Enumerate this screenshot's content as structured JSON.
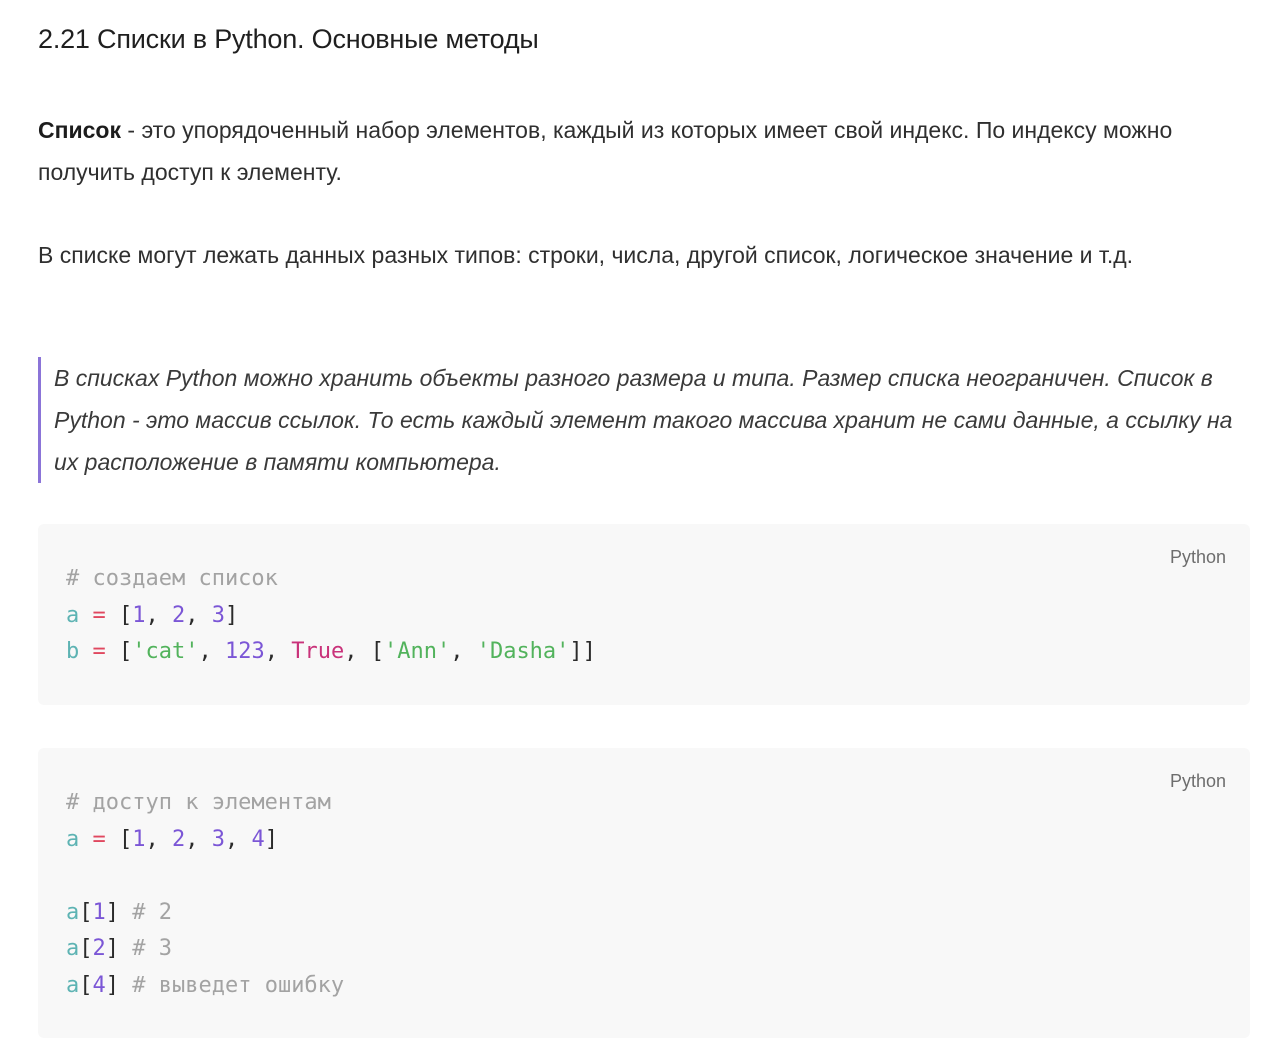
{
  "title": "2.21 Списки в Python. Основные методы",
  "para1": {
    "term": "Список",
    "text": " - это упорядоченный набор элементов, каждый из которых имеет свой индекс. По индексу можно получить доступ к элементу."
  },
  "para2": "В списке могут лежать данных разных типов: строки, числа, другой список, логическое значение и т.д.",
  "quote": "В списках Python можно хранить объекты разного размера и типа. Размер списка неограничен. Список в Python - это массив ссылок. То есть каждый элемент такого массива хранит не сами данные, а ссылку на их расположение в памяти компьютера.",
  "code_blocks": [
    {
      "language": "Python",
      "lines": [
        [
          {
            "t": "# создаем список",
            "k": "comment"
          }
        ],
        [
          {
            "t": "a",
            "k": "var"
          },
          {
            "t": " ",
            "k": "punc"
          },
          {
            "t": "=",
            "k": "op"
          },
          {
            "t": " [",
            "k": "punc"
          },
          {
            "t": "1",
            "k": "num"
          },
          {
            "t": ", ",
            "k": "punc"
          },
          {
            "t": "2",
            "k": "num"
          },
          {
            "t": ", ",
            "k": "punc"
          },
          {
            "t": "3",
            "k": "num"
          },
          {
            "t": "]",
            "k": "punc"
          }
        ],
        [
          {
            "t": "b",
            "k": "var"
          },
          {
            "t": " ",
            "k": "punc"
          },
          {
            "t": "=",
            "k": "op"
          },
          {
            "t": " [",
            "k": "punc"
          },
          {
            "t": "'cat'",
            "k": "str"
          },
          {
            "t": ", ",
            "k": "punc"
          },
          {
            "t": "123",
            "k": "num"
          },
          {
            "t": ", ",
            "k": "punc"
          },
          {
            "t": "True",
            "k": "bool"
          },
          {
            "t": ", [",
            "k": "punc"
          },
          {
            "t": "'Ann'",
            "k": "str"
          },
          {
            "t": ", ",
            "k": "punc"
          },
          {
            "t": "'Dasha'",
            "k": "str"
          },
          {
            "t": "]]",
            "k": "punc"
          }
        ]
      ]
    },
    {
      "language": "Python",
      "lines": [
        [
          {
            "t": "# доступ к элементам",
            "k": "comment"
          }
        ],
        [
          {
            "t": "a",
            "k": "var"
          },
          {
            "t": " ",
            "k": "punc"
          },
          {
            "t": "=",
            "k": "op"
          },
          {
            "t": " [",
            "k": "punc"
          },
          {
            "t": "1",
            "k": "num"
          },
          {
            "t": ", ",
            "k": "punc"
          },
          {
            "t": "2",
            "k": "num"
          },
          {
            "t": ", ",
            "k": "punc"
          },
          {
            "t": "3",
            "k": "num"
          },
          {
            "t": ", ",
            "k": "punc"
          },
          {
            "t": "4",
            "k": "num"
          },
          {
            "t": "]",
            "k": "punc"
          }
        ],
        [],
        [
          {
            "t": "a",
            "k": "var"
          },
          {
            "t": "[",
            "k": "punc"
          },
          {
            "t": "1",
            "k": "num"
          },
          {
            "t": "] ",
            "k": "punc"
          },
          {
            "t": "# 2",
            "k": "comment"
          }
        ],
        [
          {
            "t": "a",
            "k": "var"
          },
          {
            "t": "[",
            "k": "punc"
          },
          {
            "t": "2",
            "k": "num"
          },
          {
            "t": "] ",
            "k": "punc"
          },
          {
            "t": "# 3",
            "k": "comment"
          }
        ],
        [
          {
            "t": "a",
            "k": "var"
          },
          {
            "t": "[",
            "k": "punc"
          },
          {
            "t": "4",
            "k": "num"
          },
          {
            "t": "] ",
            "k": "punc"
          },
          {
            "t": "# выведет ошибку",
            "k": "comment"
          }
        ]
      ]
    }
  ]
}
